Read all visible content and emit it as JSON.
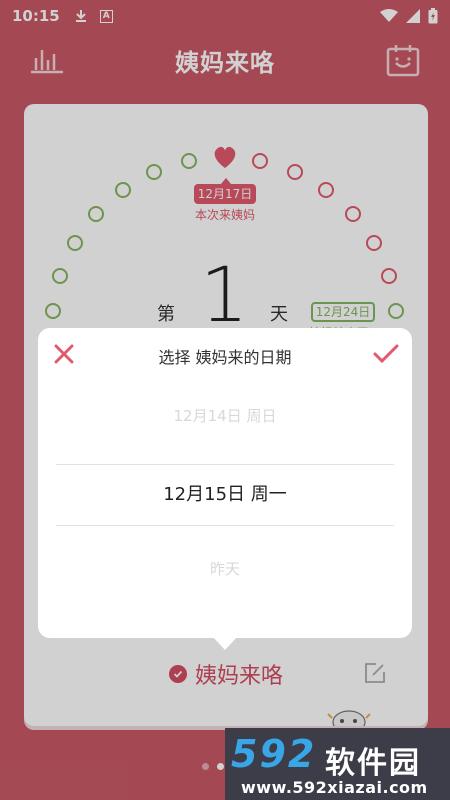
{
  "status_bar": {
    "time": "10:15"
  },
  "app_bar": {
    "title": "姨妈来咯"
  },
  "calendar": {
    "bubble_date": "12月17日",
    "bubble_label": "本次来姨妈",
    "right_badge": "12月24日",
    "right_badge_sub": "姨妈结束了",
    "day_prefix": "第",
    "day_number": "1",
    "day_suffix": "天"
  },
  "arrived_button": {
    "label": "姨妈来咯"
  },
  "dialog": {
    "title": "选择 姨妈来的日期",
    "previous_option": "12月14日 周日",
    "selected_option": "12月15日 周一",
    "next_option": "昨天"
  },
  "pager": {
    "count": 3,
    "active": 1
  },
  "watermark": {
    "brand": "592",
    "brand_cn": "软件园",
    "url": "www.592xiazai.com"
  },
  "colors": {
    "background": "#c85a66",
    "accent": "#e15a6c",
    "green": "#86b561"
  }
}
